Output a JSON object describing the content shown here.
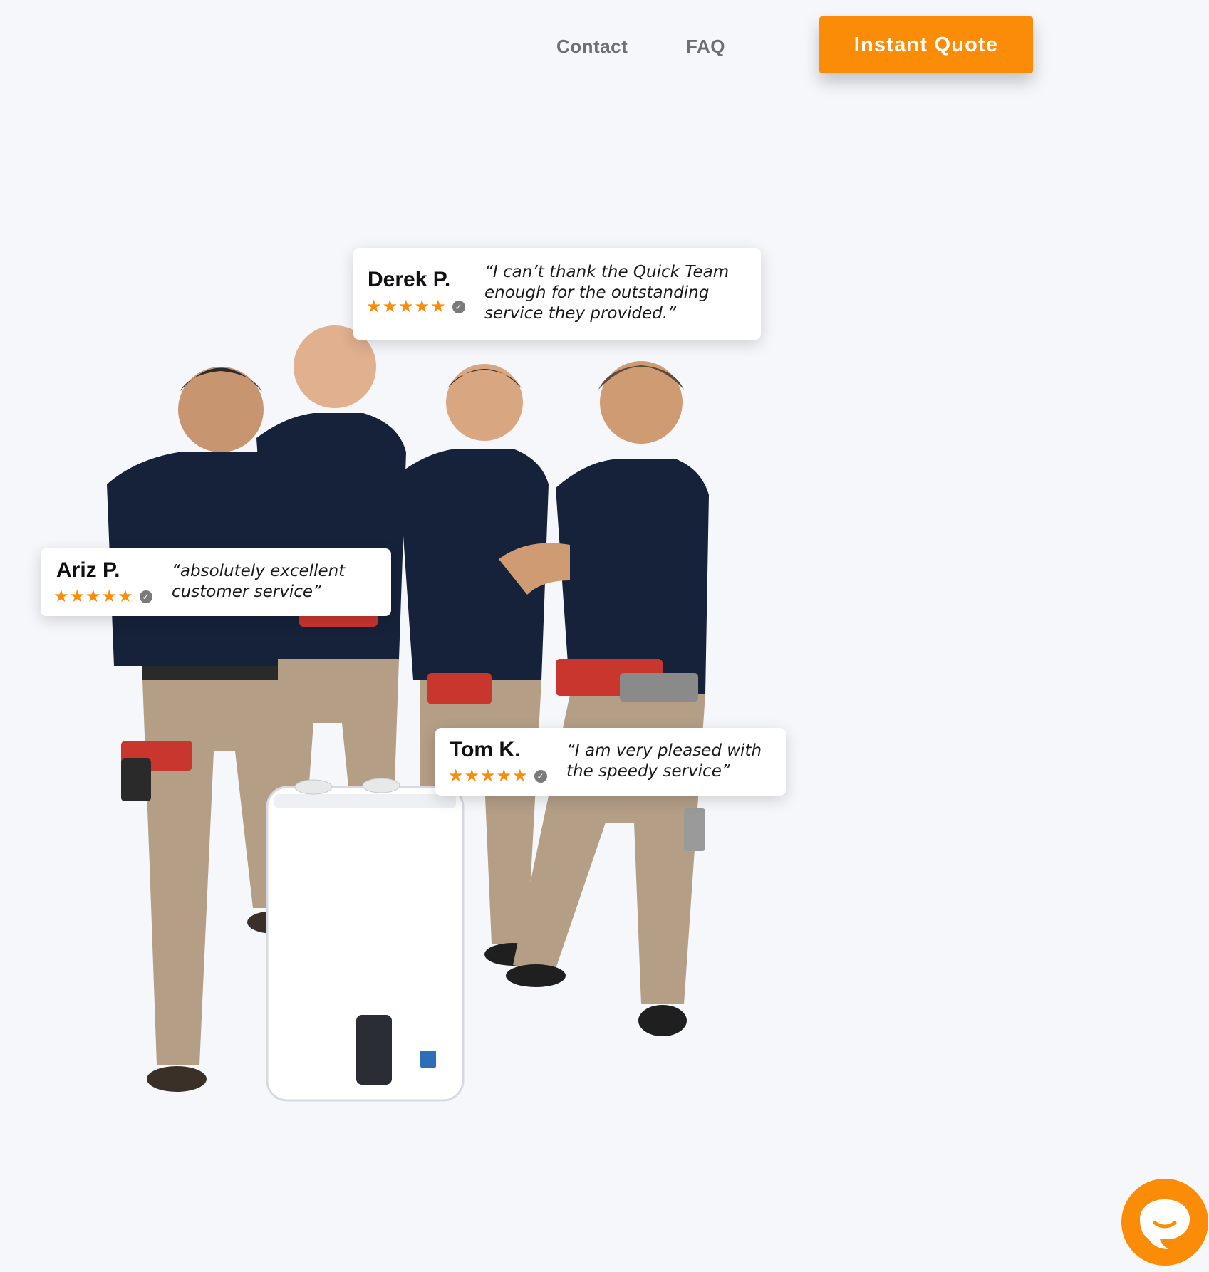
{
  "nav": {
    "contact_label": "Contact",
    "faq_label": "FAQ",
    "cta_label": "Instant Quote"
  },
  "colors": {
    "accent": "#fb8c07",
    "background": "#f6f7fb",
    "shirt": "#16223a",
    "pants": "#b49e86"
  },
  "reviews": [
    {
      "name": "Derek P.",
      "rating": 5,
      "quote": "“I can’t thank the Quick Team enough for the outstanding service they provided.”"
    },
    {
      "name": "Ariz P.",
      "rating": 5,
      "quote": "“absolutely excellent customer service”"
    },
    {
      "name": "Tom K.",
      "rating": 5,
      "quote": "“I am very pleased with the speedy service”"
    }
  ],
  "chat_widget": {
    "icon": "chat-icon"
  }
}
